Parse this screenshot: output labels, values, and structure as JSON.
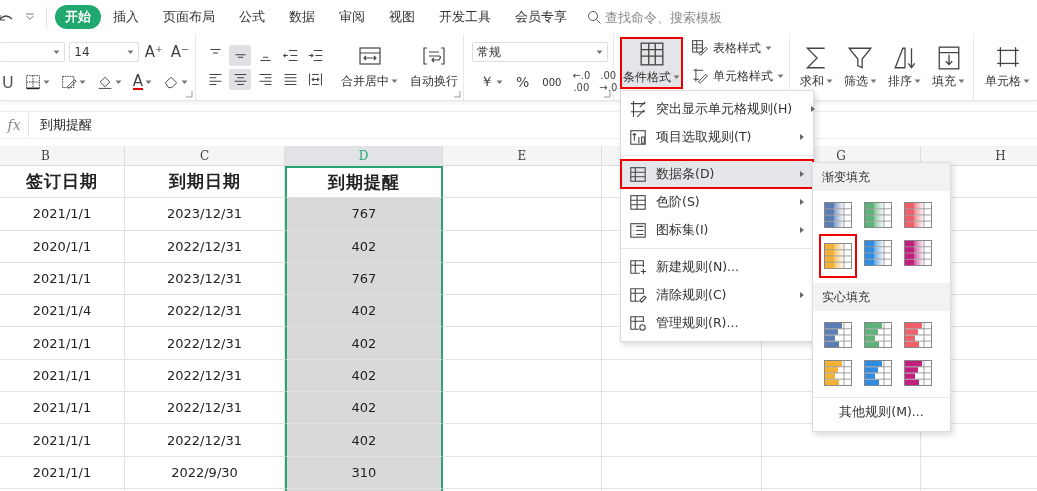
{
  "tabs": [
    {
      "label": "开始",
      "selected": true
    },
    {
      "label": "插入",
      "selected": false
    },
    {
      "label": "页面布局",
      "selected": false
    },
    {
      "label": "公式",
      "selected": false
    },
    {
      "label": "数据",
      "selected": false
    },
    {
      "label": "审阅",
      "selected": false
    },
    {
      "label": "视图",
      "selected": false
    },
    {
      "label": "开发工具",
      "selected": false
    },
    {
      "label": "会员专享",
      "selected": false
    }
  ],
  "search": {
    "placeholder": "查找命令、搜索模板"
  },
  "ribbon": {
    "font": {
      "size": "14",
      "increase_size": "A⁺",
      "decrease_size": "A⁻",
      "underline": "U",
      "font_color": "A"
    },
    "alignment": {
      "merge": "合并居中",
      "wrap": "自动换行"
    },
    "number": {
      "format": "常规",
      "currency": "￥",
      "percent": "%",
      "thousands": "000",
      "increase_decimal": [
        "←.0",
        ".00"
      ],
      "decrease_decimal": [
        ".00",
        "→.0"
      ]
    },
    "buttons": [
      {
        "label": "条件格式",
        "kind": "large",
        "outlined": true,
        "dropdown": true
      },
      {
        "label": "表格样式",
        "kind": "small",
        "outlined": false,
        "dropdown": true
      },
      {
        "label": "单元格样式",
        "kind": "small",
        "outlined": false,
        "dropdown": true
      },
      {
        "label": "求和",
        "kind": "large",
        "outlined": false,
        "dropdown": true
      },
      {
        "label": "筛选",
        "kind": "large",
        "outlined": false,
        "dropdown": true
      },
      {
        "label": "排序",
        "kind": "large",
        "outlined": false,
        "dropdown": true
      },
      {
        "label": "填充",
        "kind": "large",
        "outlined": false,
        "dropdown": true
      },
      {
        "label": "单元格",
        "kind": "large",
        "outlined": false,
        "dropdown": true
      }
    ]
  },
  "formula_bar": {
    "label": "fx",
    "value": "到期提醒"
  },
  "sheet": {
    "columns": [
      {
        "letter": "B",
        "selected": false
      },
      {
        "letter": "C",
        "selected": false
      },
      {
        "letter": "D",
        "selected": true
      },
      {
        "letter": "E",
        "selected": false
      },
      {
        "selected": false
      },
      {
        "letter": "G",
        "selected": false
      },
      {
        "letter": "H",
        "selected": false
      }
    ],
    "rows": [
      {
        "kind": "header",
        "cells": [
          "签订日期",
          "到期日期",
          "到期提醒"
        ]
      },
      {
        "kind": "data",
        "cells": [
          "2021/1/1",
          "2023/12/31",
          "767"
        ]
      },
      {
        "kind": "data",
        "cells": [
          "2020/1/1",
          "2022/12/31",
          "402"
        ]
      },
      {
        "kind": "data",
        "cells": [
          "2021/1/1",
          "2023/12/31",
          "767"
        ]
      },
      {
        "kind": "data",
        "cells": [
          "2021/1/4",
          "2022/12/31",
          "402"
        ]
      },
      {
        "kind": "data",
        "cells": [
          "2021/1/1",
          "2022/12/31",
          "402"
        ]
      },
      {
        "kind": "data",
        "cells": [
          "2021/1/1",
          "2022/12/31",
          "402"
        ]
      },
      {
        "kind": "data",
        "cells": [
          "2021/1/1",
          "2022/12/31",
          "402"
        ]
      },
      {
        "kind": "data",
        "cells": [
          "2021/1/1",
          "2022/12/31",
          "402"
        ]
      },
      {
        "kind": "data",
        "cells": [
          "2021/1/1",
          "2022/9/30",
          "310"
        ]
      }
    ]
  },
  "menu": {
    "items": [
      {
        "label": "突出显示单元格规则(H)",
        "submenu": true,
        "selected": false,
        "outlined": false
      },
      {
        "label": "项目选取规则(T)",
        "submenu": true,
        "selected": false,
        "outlined": false,
        "separator_after": true
      },
      {
        "label": "数据条(D)",
        "submenu": true,
        "selected": true,
        "outlined": true
      },
      {
        "label": "色阶(S)",
        "submenu": true,
        "selected": false,
        "outlined": false
      },
      {
        "label": "图标集(I)",
        "submenu": true,
        "selected": false,
        "outlined": false,
        "separator_after": true
      },
      {
        "label": "新建规则(N)...",
        "submenu": false,
        "selected": false,
        "outlined": false
      },
      {
        "label": "清除规则(C)",
        "submenu": true,
        "selected": false,
        "outlined": false
      },
      {
        "label": "管理规则(R)...",
        "submenu": false,
        "selected": false,
        "outlined": false
      }
    ]
  },
  "submenu": {
    "sections": [
      {
        "title": "渐变填充",
        "kind": "gradient",
        "swatches": [
          {
            "color": "#5a7db3",
            "outlined": false
          },
          {
            "color": "#5fb27a",
            "outlined": false
          },
          {
            "color": "#f0606a",
            "outlined": false
          },
          {
            "color": "#f3b233",
            "outlined": true
          },
          {
            "color": "#2f8ce0",
            "outlined": false
          },
          {
            "color": "#c21f7e",
            "outlined": false
          }
        ]
      },
      {
        "title": "实心填充",
        "kind": "solid",
        "swatches": [
          {
            "color": "#5a7db3",
            "outlined": false
          },
          {
            "color": "#5fb27a",
            "outlined": false
          },
          {
            "color": "#f0606a",
            "outlined": false
          },
          {
            "color": "#f3b233",
            "outlined": false
          },
          {
            "color": "#2f8ce0",
            "outlined": false
          },
          {
            "color": "#c21f7e",
            "outlined": false
          }
        ]
      }
    ],
    "footer": "其他规则(M)..."
  }
}
